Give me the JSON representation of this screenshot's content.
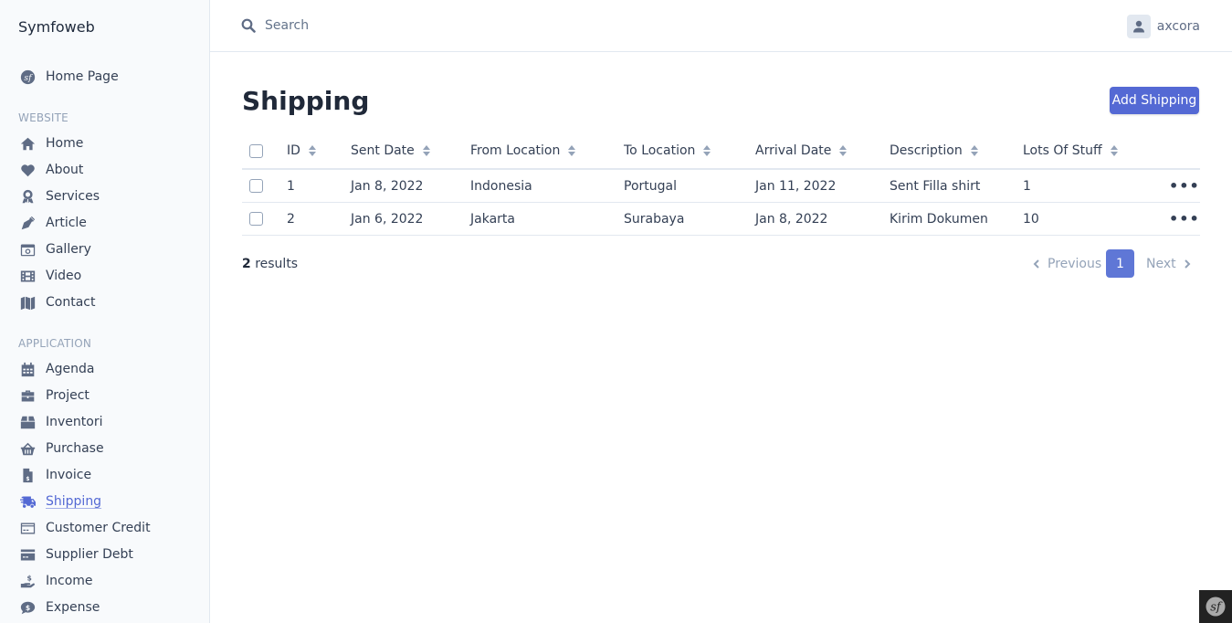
{
  "app": {
    "brand": "Symfoweb"
  },
  "sidebar": {
    "home_page": {
      "label": "Home Page",
      "icon": "symfony-icon"
    },
    "sections": [
      {
        "label": "WEBSITE",
        "items": [
          {
            "label": "Home",
            "icon": "home-icon"
          },
          {
            "label": "About",
            "icon": "heart-icon"
          },
          {
            "label": "Services",
            "icon": "award-icon"
          },
          {
            "label": "Article",
            "icon": "pen-nib-icon"
          },
          {
            "label": "Gallery",
            "icon": "camera-retro-icon"
          },
          {
            "label": "Video",
            "icon": "film-icon"
          },
          {
            "label": "Contact",
            "icon": "map-icon"
          }
        ]
      },
      {
        "label": "APPLICATION",
        "items": [
          {
            "label": "Agenda",
            "icon": "calendar-icon"
          },
          {
            "label": "Project",
            "icon": "briefcase-icon"
          },
          {
            "label": "Inventori",
            "icon": "box-icon"
          },
          {
            "label": "Purchase",
            "icon": "shopping-basket-icon"
          },
          {
            "label": "Invoice",
            "icon": "file-invoice-dollar-icon"
          },
          {
            "label": "Shipping",
            "icon": "shipping-fast-icon",
            "active": true
          },
          {
            "label": "Customer Credit",
            "icon": "credit-card-icon"
          },
          {
            "label": "Supplier Debt",
            "icon": "credit-card-solid-icon"
          },
          {
            "label": "Income",
            "icon": "hand-holding-usd-icon"
          },
          {
            "label": "Expense",
            "icon": "comment-dollar-icon"
          }
        ]
      }
    ]
  },
  "topbar": {
    "search_placeholder": "Search",
    "search_value": "",
    "username": "axcora"
  },
  "main": {
    "title": "Shipping",
    "add_button": "Add Shipping",
    "table": {
      "columns": [
        "ID",
        "Sent Date",
        "From Location",
        "To Location",
        "Arrival Date",
        "Description",
        "Lots Of Stuff"
      ],
      "rows": [
        [
          "1",
          "Jan 8, 2022",
          "Indonesia",
          "Portugal",
          "Jan 11, 2022",
          "Sent Filla shirt",
          "1"
        ],
        [
          "2",
          "Jan 6, 2022",
          "Jakarta",
          "Surabaya",
          "Jan 8, 2022",
          "Kirim Dokumen",
          "10"
        ]
      ],
      "row_actions": "•••"
    },
    "results": {
      "count": "2",
      "label": " results"
    },
    "pagination": {
      "previous": "Previous",
      "current": "1",
      "next": "Next"
    }
  },
  "colors": {
    "accent": "#5469d4",
    "page_active": "#5f77d6",
    "sidebar_bg": "#f8fafc",
    "border": "#e2e8f0"
  }
}
